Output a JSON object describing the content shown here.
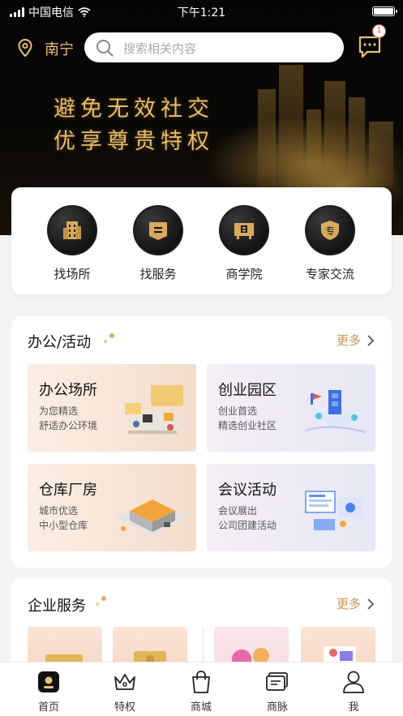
{
  "status_bar": {
    "carrier": "中国电信",
    "time": "下午1:21"
  },
  "header": {
    "city": "南宁",
    "search_placeholder": "搜索相关内容",
    "message_badge": "1"
  },
  "banner": {
    "line1": "避免无效社交",
    "line2": "优享尊贵特权"
  },
  "quick_menu": [
    {
      "label": "找场所",
      "icon": "building-icon"
    },
    {
      "label": "找服务",
      "icon": "service-icon"
    },
    {
      "label": "商学院",
      "icon": "school-icon"
    },
    {
      "label": "专家交流",
      "icon": "expert-icon",
      "glyph": "专"
    }
  ],
  "office_section": {
    "title": "办公/活动",
    "more": "更多",
    "tiles": [
      {
        "title": "办公场所",
        "line1": "为您精选",
        "line2": "舒适办公环境"
      },
      {
        "title": "创业园区",
        "line1": "创业首选",
        "line2": "精选创业社区"
      },
      {
        "title": "仓库厂房",
        "line1": "城市优选",
        "line2": "中小型仓库"
      },
      {
        "title": "会议活动",
        "line1": "会议展出",
        "line2": "公司团建活动"
      }
    ]
  },
  "enterprise_section": {
    "title": "企业服务",
    "more": "更多"
  },
  "tabbar": [
    {
      "label": "首页",
      "icon": "home-icon",
      "active": true
    },
    {
      "label": "特权",
      "icon": "crown-icon"
    },
    {
      "label": "商城",
      "icon": "shopping-bag-icon"
    },
    {
      "label": "商脉",
      "icon": "business-card-icon"
    },
    {
      "label": "我",
      "icon": "user-icon"
    }
  ],
  "colors": {
    "gold": "#e7bd6c",
    "accent": "#c8955a",
    "badge": "#e4574a"
  }
}
